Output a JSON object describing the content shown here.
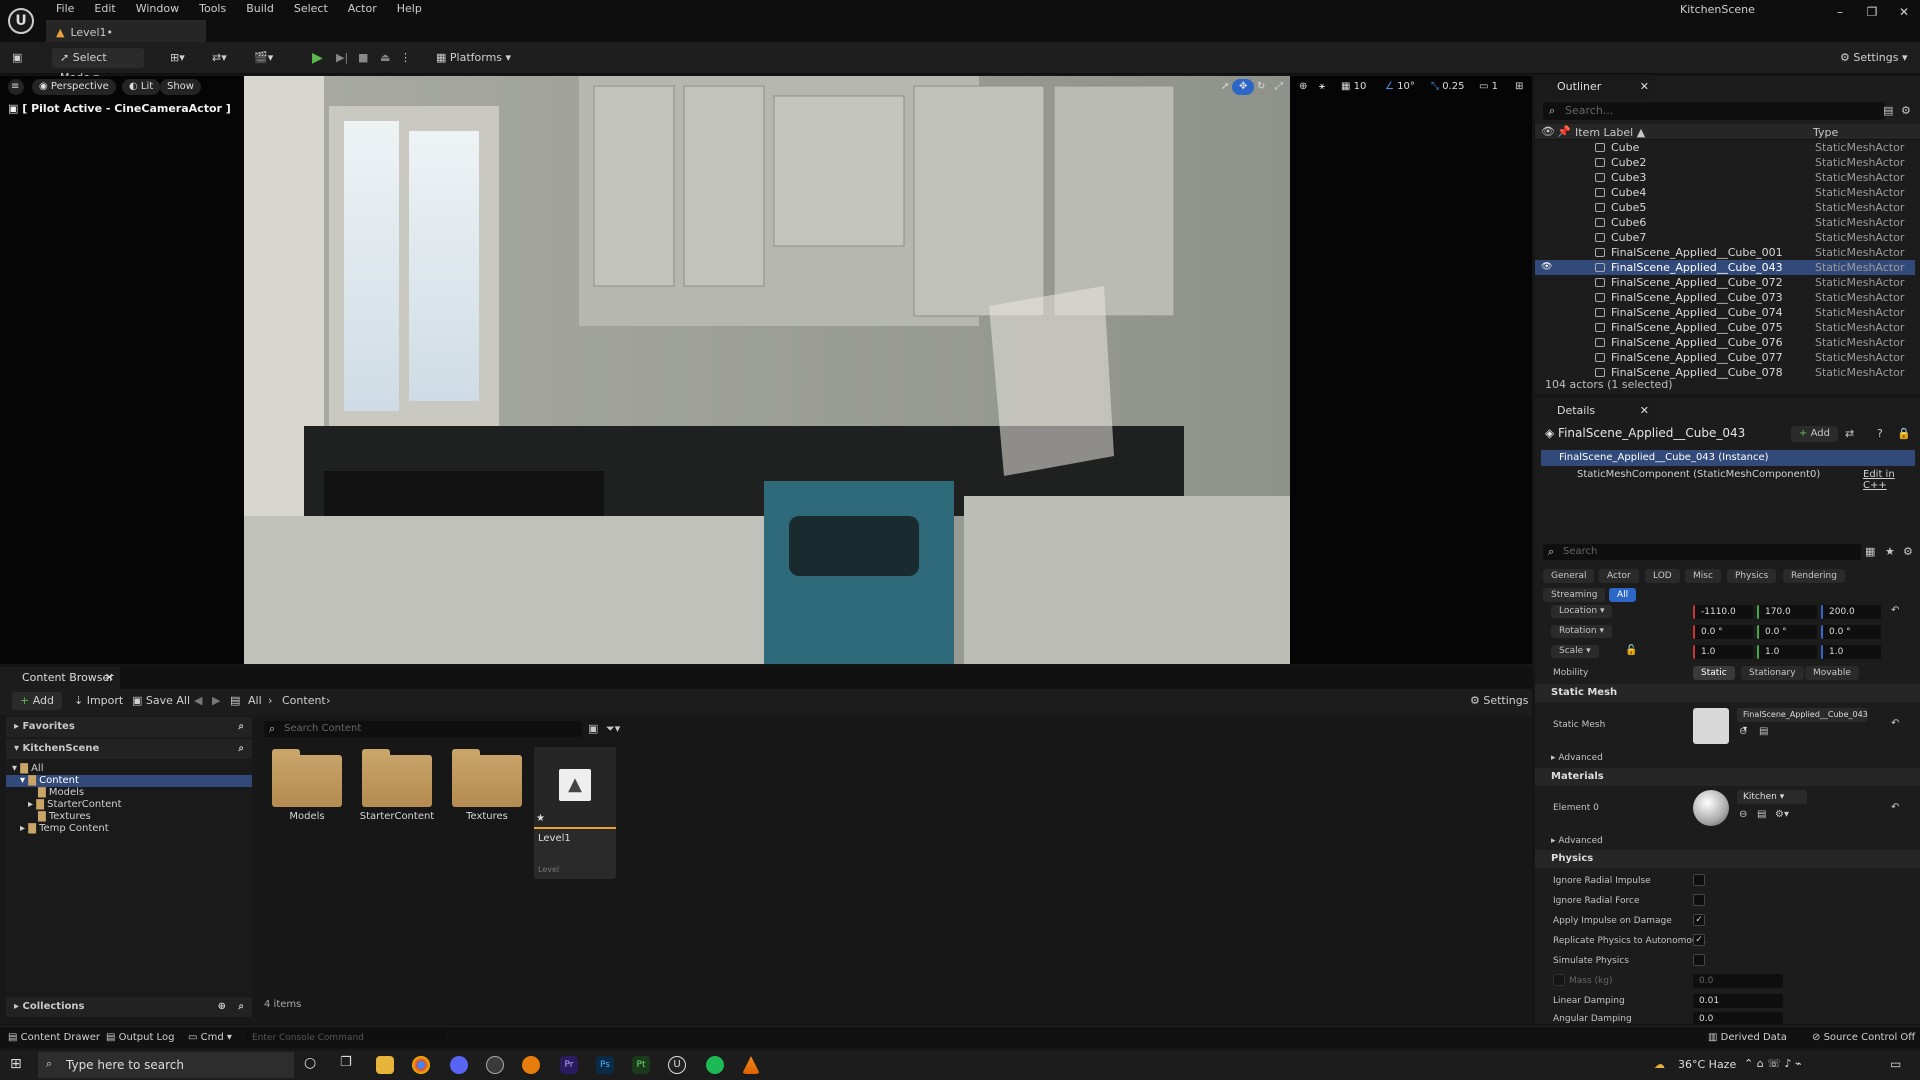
{
  "app": {
    "window_title": "KitchenScene",
    "level_tab": "Level1•"
  },
  "menu": [
    "File",
    "Edit",
    "Window",
    "Tools",
    "Build",
    "Select",
    "Actor",
    "Help"
  ],
  "toolbar": {
    "mode": "Select Mode",
    "platforms": "Platforms",
    "settings": "Settings"
  },
  "viewport": {
    "perspective": "Perspective",
    "lit": "Lit",
    "show": "Show",
    "pilot": "[ Pilot Active - CineCameraActor ]",
    "grid_snap": "10",
    "rot_snap": "10°",
    "scale_snap": "0.25",
    "cam_speed": "1"
  },
  "outliner": {
    "title": "Outliner",
    "search_placeholder": "Search...",
    "col_label": "Item Label ▲",
    "col_type": "Type",
    "rows": [
      {
        "name": "Cube",
        "type": "StaticMeshActor"
      },
      {
        "name": "Cube2",
        "type": "StaticMeshActor"
      },
      {
        "name": "Cube3",
        "type": "StaticMeshActor"
      },
      {
        "name": "Cube4",
        "type": "StaticMeshActor"
      },
      {
        "name": "Cube5",
        "type": "StaticMeshActor"
      },
      {
        "name": "Cube6",
        "type": "StaticMeshActor"
      },
      {
        "name": "Cube7",
        "type": "StaticMeshActor"
      },
      {
        "name": "FinalScene_Applied__Cube_001",
        "type": "StaticMeshActor"
      },
      {
        "name": "FinalScene_Applied__Cube_043",
        "type": "StaticMeshActor"
      },
      {
        "name": "FinalScene_Applied__Cube_072",
        "type": "StaticMeshActor"
      },
      {
        "name": "FinalScene_Applied__Cube_073",
        "type": "StaticMeshActor"
      },
      {
        "name": "FinalScene_Applied__Cube_074",
        "type": "StaticMeshActor"
      },
      {
        "name": "FinalScene_Applied__Cube_075",
        "type": "StaticMeshActor"
      },
      {
        "name": "FinalScene_Applied__Cube_076",
        "type": "StaticMeshActor"
      },
      {
        "name": "FinalScene_Applied__Cube_077",
        "type": "StaticMeshActor"
      },
      {
        "name": "FinalScene_Applied__Cube_078",
        "type": "StaticMeshActor"
      }
    ],
    "count": "104 actors (1 selected)"
  },
  "details": {
    "title": "Details",
    "actor": "FinalScene_Applied__Cube_043",
    "add": "Add",
    "instance": "FinalScene_Applied__Cube_043 (Instance)",
    "component": "StaticMeshComponent (StaticMeshComponent0)",
    "edit_cpp": "Edit in C++",
    "search_placeholder": "Search",
    "filters": [
      "General",
      "Actor",
      "LOD",
      "Misc",
      "Physics",
      "Rendering",
      "Streaming",
      "All"
    ],
    "location": {
      "label": "Location",
      "x": "-1110.0",
      "y": "170.0",
      "z": "200.0"
    },
    "rotation": {
      "label": "Rotation",
      "x": "0.0 °",
      "y": "0.0 °",
      "z": "0.0 °"
    },
    "scale": {
      "label": "Scale",
      "x": "1.0",
      "y": "1.0",
      "z": "1.0"
    },
    "mobility": {
      "label": "Mobility",
      "opts": [
        "Static",
        "Stationary",
        "Movable"
      ]
    },
    "static_mesh_section": "Static Mesh",
    "static_mesh_label": "Static Mesh",
    "static_mesh_value": "FinalScene_Applied__Cube_043",
    "advanced": "Advanced",
    "materials_section": "Materials",
    "element0": "Element 0",
    "material_value": "Kitchen",
    "physics_section": "Physics",
    "physics": [
      {
        "label": "Ignore Radial Impulse",
        "checked": ""
      },
      {
        "label": "Ignore Radial Force",
        "checked": ""
      },
      {
        "label": "Apply Impulse on Damage",
        "checked": "✓"
      },
      {
        "label": "Replicate Physics to Autonomou...",
        "checked": "✓"
      },
      {
        "label": "Simulate Physics",
        "checked": ""
      }
    ],
    "mass_label": "Mass (kg)",
    "mass_value": "0.0",
    "linear_damping_label": "Linear Damping",
    "linear_damping_value": "0.01",
    "angular_damping_label": "Angular Damping",
    "angular_damping_value": "0.0"
  },
  "content_browser": {
    "tab": "Content Browser",
    "add": "Add",
    "import": "Import",
    "save_all": "Save All",
    "crumb_all": "All",
    "crumb_content": "Content",
    "settings": "Settings",
    "favorites": "Favorites",
    "project": "KitchenScene",
    "tree": [
      {
        "label": "All",
        "indent": 0
      },
      {
        "label": "Content",
        "indent": 1
      },
      {
        "label": "Models",
        "indent": 2
      },
      {
        "label": "StarterContent",
        "indent": 2
      },
      {
        "label": "Textures",
        "indent": 2
      },
      {
        "label": "Temp Content",
        "indent": 1
      }
    ],
    "search_placeholder": "Search Content",
    "items": [
      "Models",
      "StarterContent",
      "Textures",
      "Level1"
    ],
    "level_type": "Level",
    "item_count": "4 items",
    "collections": "Collections"
  },
  "statusbar": {
    "drawer": "Content Drawer",
    "output": "Output Log",
    "cmd": "Cmd",
    "console_placeholder": "Enter Console Command",
    "derived": "Derived Data",
    "source": "Source Control Off"
  },
  "taskbar": {
    "search": "Type here to search",
    "weather": "36°C  Haze"
  }
}
